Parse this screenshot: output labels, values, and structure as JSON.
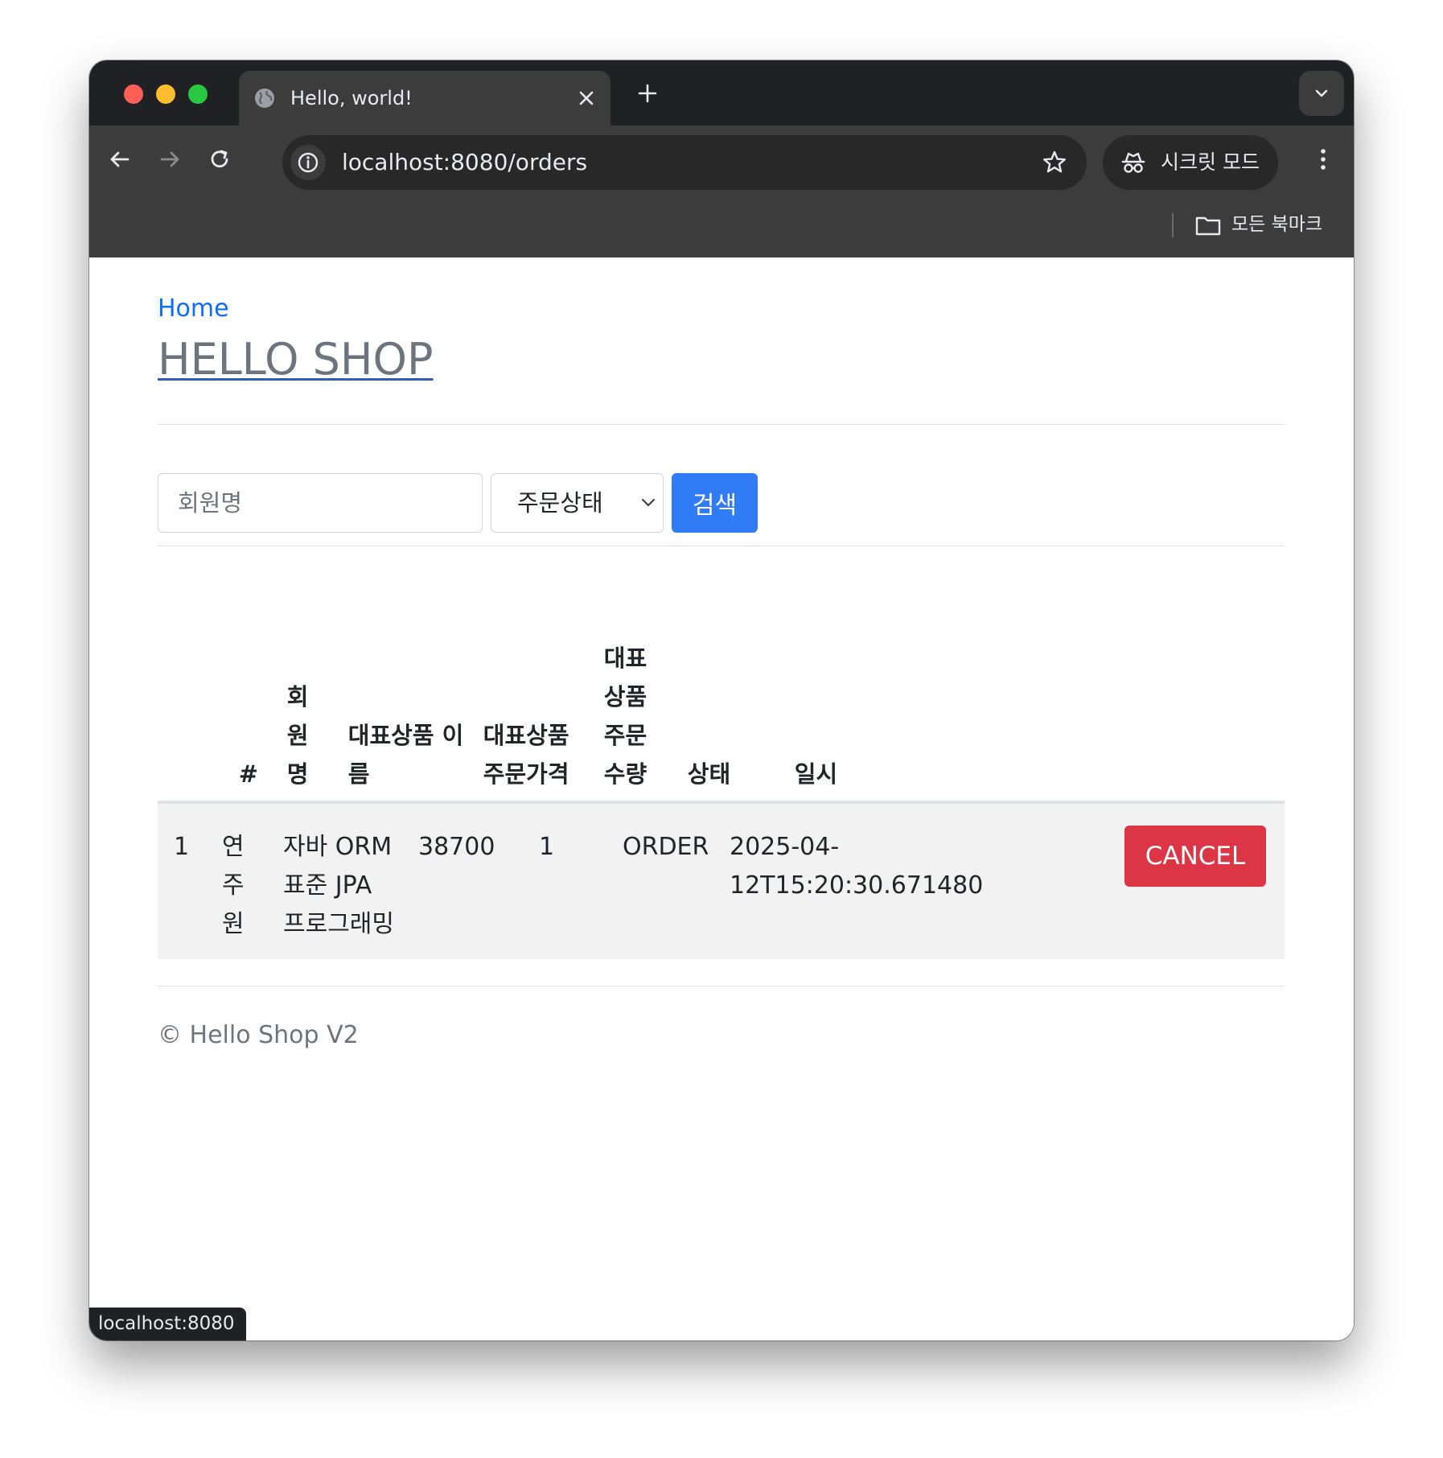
{
  "browser": {
    "tab_title": "Hello, world!",
    "url": "localhost:8080/orders",
    "incognito_label": "시크릿 모드",
    "bookmarks_label": "모든 북마크",
    "status_url": "localhost:8080"
  },
  "page": {
    "home_link": "Home",
    "title": "HELLO SHOP",
    "footer": "© Hello Shop V2"
  },
  "search": {
    "member_placeholder": "회원명",
    "status_selected": "주문상태",
    "search_button": "검색"
  },
  "table": {
    "headers": {
      "num": "#",
      "member": "회\n원\n명",
      "item_name": "대표상품 이\n름",
      "price": "대표상품\n주문가격",
      "count": "대표\n상품\n주문\n수량",
      "status": "상태",
      "date": "일시"
    },
    "rows": [
      {
        "num": "1",
        "member": "연\n주\n원",
        "item_name": "자바 ORM\n표준 JPA\n프로그래밍",
        "price": "38700",
        "count": "1",
        "status": "ORDER",
        "date": "2025-04-\n12T15:20:30.671480",
        "action": "CANCEL"
      }
    ]
  },
  "colors": {
    "link": "#0d6efd",
    "primary_button": "#2f7cf6",
    "danger_button": "#dc3545",
    "row_background": "#f2f2f2"
  }
}
